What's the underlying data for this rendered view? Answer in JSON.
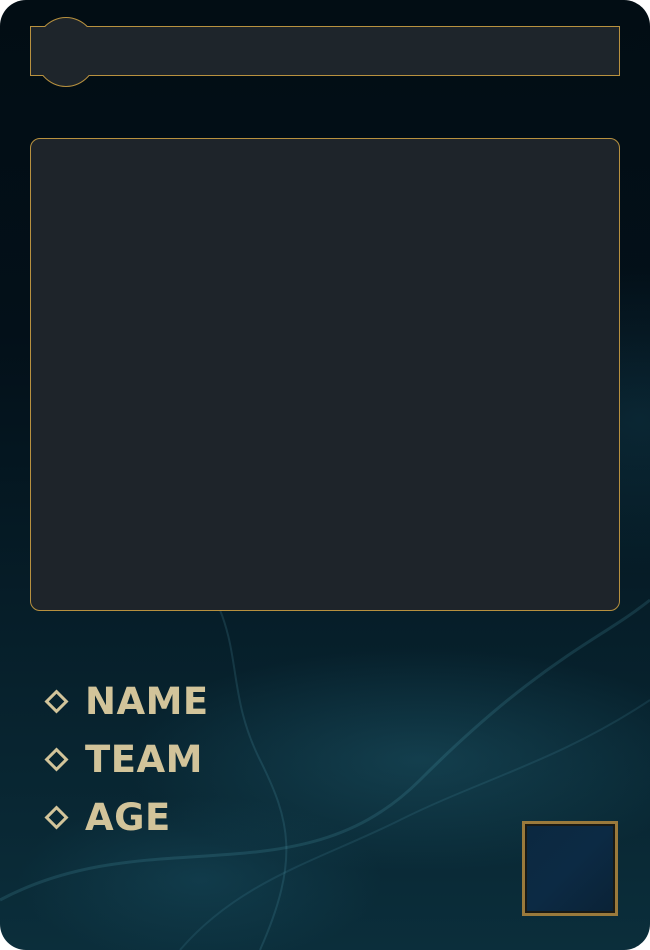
{
  "card": {
    "stats": [
      {
        "label": "NAME"
      },
      {
        "label": "TEAM"
      },
      {
        "label": "AGE"
      }
    ]
  },
  "colors": {
    "gold_border": "#b8913f",
    "label_text": "#d2c49a",
    "panel_fill": "#1e242a",
    "background_dark": "#020d14",
    "background_teal": "#0b2e3b"
  }
}
